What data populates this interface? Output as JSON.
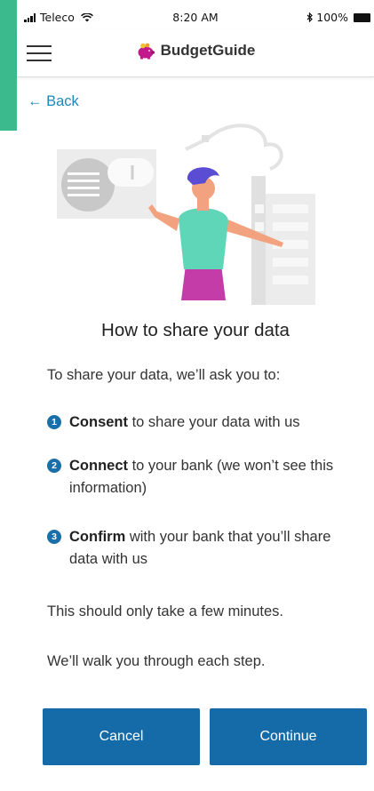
{
  "status_bar": {
    "carrier": "Teleco",
    "time": "8:20 AM",
    "battery": "100%"
  },
  "nav": {
    "brand": "BudgetGuide"
  },
  "back_label": "← Back",
  "heading": "How to share your data",
  "intro": "To share your data, we’ll ask you to:",
  "steps": [
    {
      "number": "1",
      "bold": "Consent",
      "rest": " to share your data with us"
    },
    {
      "number": "2",
      "bold": "Connect",
      "rest": " to your bank (we won’t see this information)"
    },
    {
      "number": "3",
      "bold": "Confirm",
      "rest": " with your bank that you’ll share data with us"
    }
  ],
  "notes": [
    "This should only take a few minutes.",
    "We’ll walk you through each step."
  ],
  "buttons": {
    "cancel": "Cancel",
    "continue": "Continue"
  },
  "colors": {
    "accent_green": "#3bba8e",
    "primary_blue": "#156ba8",
    "link_blue": "#1f87b7",
    "logo_pink": "#c2188c"
  },
  "icons": [
    "signal-icon",
    "wifi-icon",
    "bluetooth-icon",
    "battery-icon",
    "hamburger-menu-icon",
    "piggy-bank-logo-icon"
  ]
}
